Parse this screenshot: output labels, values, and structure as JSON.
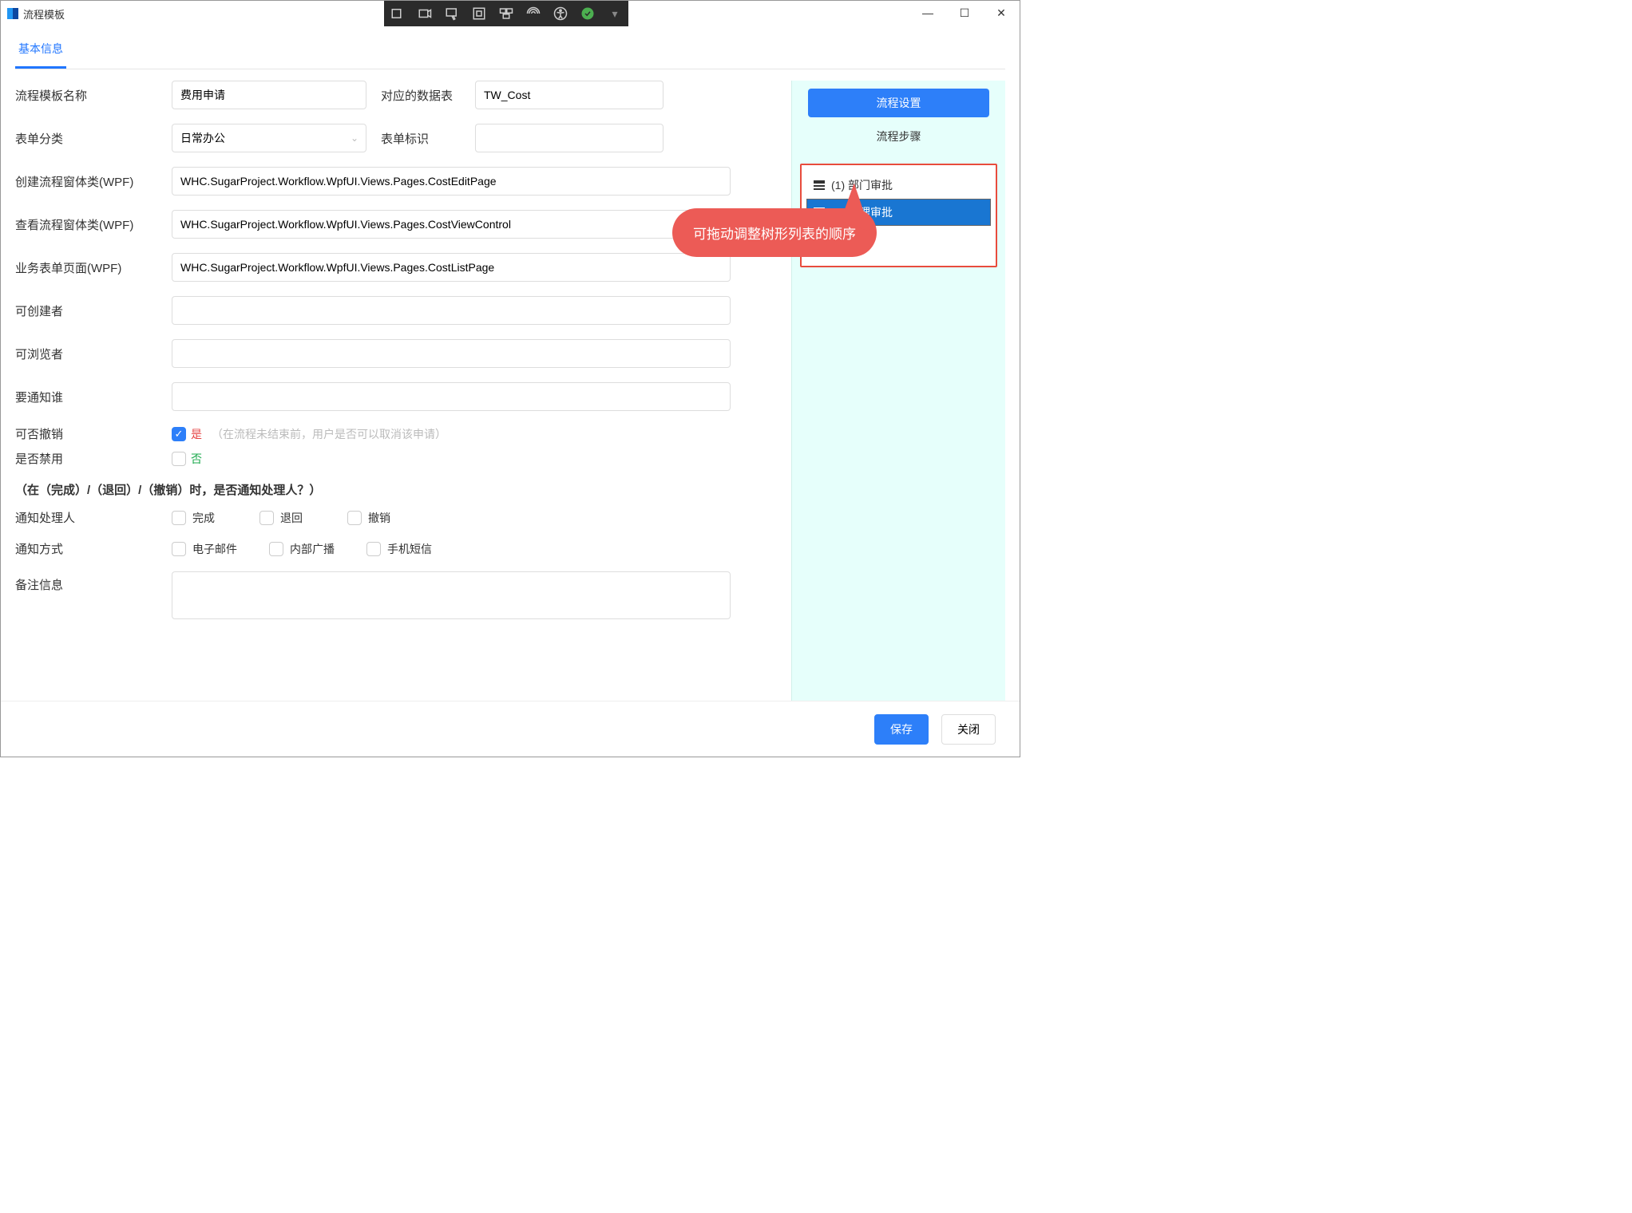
{
  "window": {
    "title": "流程模板"
  },
  "tabs": {
    "basic": "基本信息"
  },
  "labels": {
    "templateName": "流程模板名称",
    "dataTable": "对应的数据表",
    "category": "表单分类",
    "formId": "表单标识",
    "createWpf": "创建流程窗体类(WPF)",
    "viewWpf": "查看流程窗体类(WPF)",
    "listWpf": "业务表单页面(WPF)",
    "creator": "可创建者",
    "viewer": "可浏览者",
    "notifyWho": "要通知谁",
    "canRevoke": "可否撤销",
    "disabled": "是否禁用",
    "sectionNotify": "（在（完成）/（退回）/（撤销）时，是否通知处理人？）",
    "notifyHandler": "通知处理人",
    "notifyMethod": "通知方式",
    "remark": "备注信息"
  },
  "values": {
    "templateName": "费用申请",
    "dataTable": "TW_Cost",
    "category": "日常办公",
    "formId": "",
    "createWpf": "WHC.SugarProject.Workflow.WpfUI.Views.Pages.CostEditPage",
    "viewWpf": "WHC.SugarProject.Workflow.WpfUI.Views.Pages.CostViewControl",
    "listWpf": "WHC.SugarProject.Workflow.WpfUI.Views.Pages.CostListPage",
    "creator": "",
    "viewer": "",
    "notifyWho": "",
    "canRevoke": "是",
    "canRevokeHint": "（在流程未结束前，用户是否可以取消该申请）",
    "disabled": "否",
    "remark": ""
  },
  "checks": {
    "done": "完成",
    "back": "退回",
    "revoke": "撤销",
    "email": "电子邮件",
    "broadcast": "内部广播",
    "sms": "手机短信"
  },
  "right": {
    "settings": "流程设置",
    "steps": "流程步骤",
    "step1": "(1) 部门审批",
    "step2": "(2) 经理审批"
  },
  "callout": "可拖动调整树形列表的顺序",
  "footer": {
    "save": "保存",
    "close": "关闭"
  }
}
